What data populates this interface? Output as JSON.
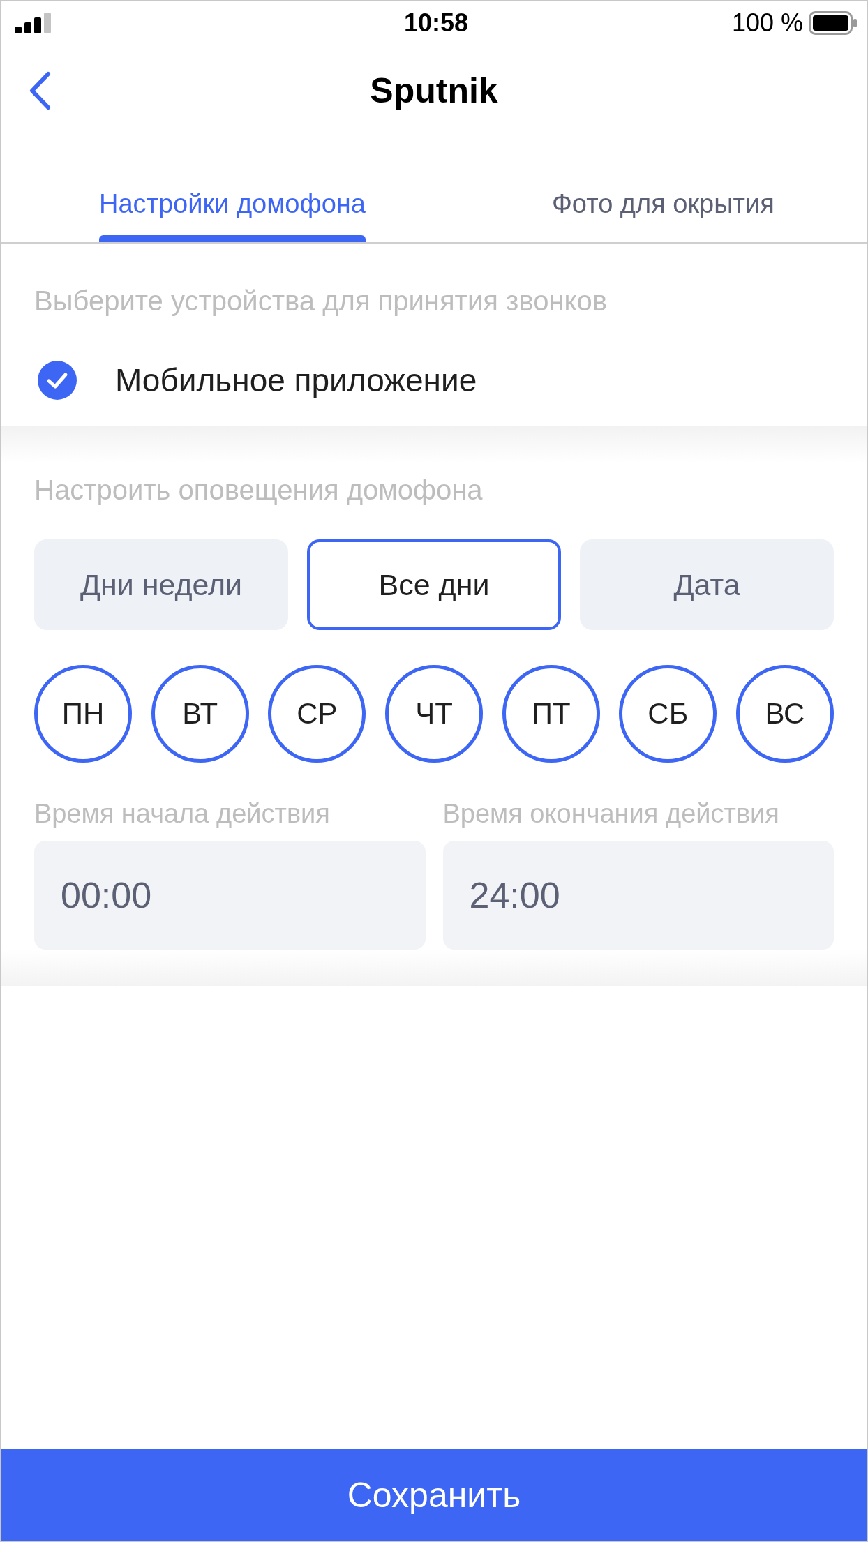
{
  "status_bar": {
    "time": "10:58",
    "battery": "100 %"
  },
  "nav": {
    "title": "Sputnik"
  },
  "tabs": [
    {
      "label": "Настройки домофона",
      "selected": true
    },
    {
      "label": "Фото для окрытия",
      "selected": false
    }
  ],
  "devices": {
    "heading": "Выберите устройства для принятия звонков",
    "options": [
      {
        "label": "Мобильное приложение",
        "checked": true
      }
    ]
  },
  "notifications": {
    "heading": "Настроить оповещения домофона",
    "modes": [
      {
        "label": "Дни недели",
        "selected": false
      },
      {
        "label": "Все дни",
        "selected": true
      },
      {
        "label": "Дата",
        "selected": false
      }
    ],
    "days": [
      {
        "label": "ПН",
        "selected": true
      },
      {
        "label": "ВТ",
        "selected": true
      },
      {
        "label": "СР",
        "selected": true
      },
      {
        "label": "ЧТ",
        "selected": true
      },
      {
        "label": "ПТ",
        "selected": true
      },
      {
        "label": "СБ",
        "selected": true
      },
      {
        "label": "ВС",
        "selected": true
      }
    ],
    "times": [
      {
        "label": "Время начала действия",
        "value": "00:00"
      },
      {
        "label": "Время окончания действия",
        "value": "24:00"
      }
    ]
  },
  "save_button": {
    "label": "Сохранить"
  }
}
